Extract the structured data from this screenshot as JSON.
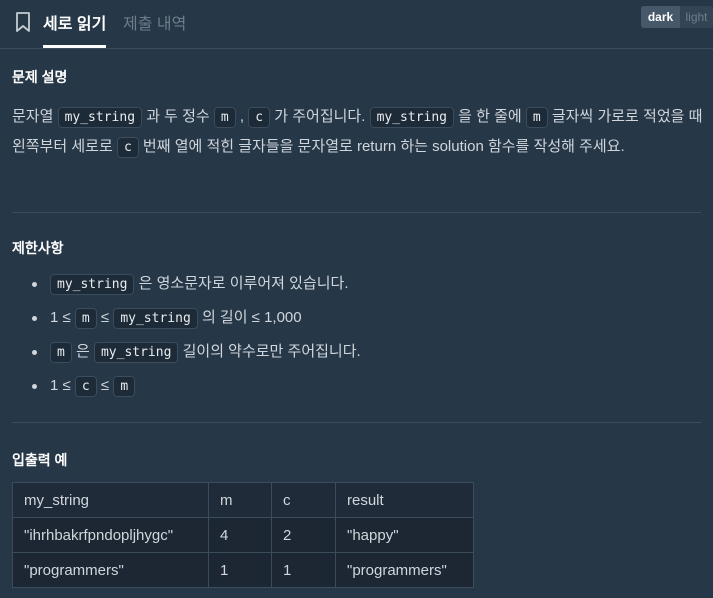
{
  "header": {
    "tab_read": "세로 읽기",
    "tab_submit": "제출 내역",
    "theme_dark": "dark",
    "theme_light": "light"
  },
  "description": {
    "title": "문제 설명",
    "p1": "문자열 ",
    "c1": "my_string",
    "p2": " 과 두 정수 ",
    "c2": "m",
    "p3": " , ",
    "c3": "c",
    "p4": " 가 주어집니다. ",
    "c4": "my_string",
    "p5": " 을 한 줄에 ",
    "c5": "m",
    "p6": " 글자씩 가로로 적었을 때 왼쪽부터 세로로 ",
    "c6": "c",
    "p7": " 번째 열에 적힌 글자들을 문자열로 return 하는 solution 함수를 작성해 주세요."
  },
  "constraints": {
    "title": "제한사항",
    "b1": {
      "code": "my_string",
      "text": " 은 영소문자로 이루어져 있습니다."
    },
    "b2": {
      "t1": "1 ≤ ",
      "c1": "m",
      "t2": " ≤ ",
      "c2": "my_string",
      "t3": " 의 길이 ≤ 1,000"
    },
    "b3": {
      "c1": "m",
      "t1": " 은 ",
      "c2": "my_string",
      "t2": " 길이의 약수로만 주어집니다."
    },
    "b4": {
      "t1": "1 ≤ ",
      "c1": "c",
      "t2": " ≤ ",
      "c2": "m"
    }
  },
  "examples": {
    "title": "입출력 예",
    "headers": [
      "my_string",
      "m",
      "c",
      "result"
    ],
    "rows": [
      [
        "\"ihrhbakrfpndopljhygc\"",
        "4",
        "2",
        "\"happy\""
      ],
      [
        "\"programmers\"",
        "1",
        "1",
        "\"programmers\""
      ]
    ]
  }
}
